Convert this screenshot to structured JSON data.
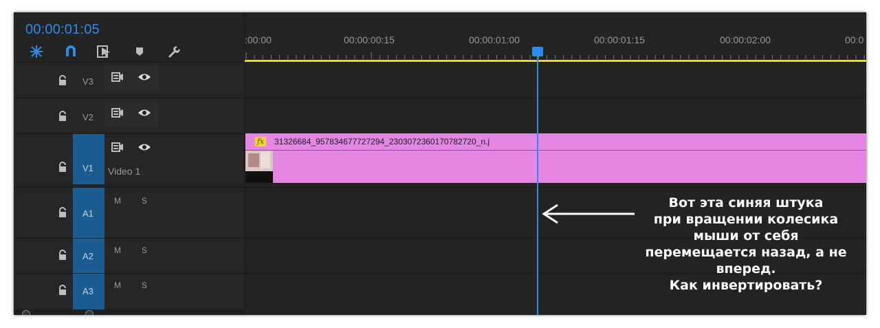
{
  "timecode": "00:00:01:05",
  "toolbar": {
    "tools": [
      "nest-icon",
      "snap-magnet-icon",
      "linked-selection-icon",
      "marker-icon",
      "wrench-icon"
    ]
  },
  "ruler": {
    "labels": [
      ":00:00",
      "00:00:00:15",
      "00:00:01:00",
      "00:00:01:15",
      "00:00:02:00",
      "00:0"
    ]
  },
  "tracks": {
    "v3": {
      "name": "V3"
    },
    "v2": {
      "name": "V2"
    },
    "v1": {
      "name": "V1",
      "label": "Video 1"
    },
    "a1": {
      "name": "A1",
      "mute": "M",
      "solo": "S"
    },
    "a2": {
      "name": "A2",
      "mute": "M",
      "solo": "S"
    },
    "a3": {
      "name": "A3",
      "mute": "M",
      "solo": "S"
    }
  },
  "clip": {
    "fx_label": "fx",
    "name": "31326684_957834677727294_2303072360170782720_n.j"
  },
  "annotation": {
    "lines": [
      "Вот эта синяя штука",
      "при вращении колесика",
      "мыши от себя",
      "перемещается назад, а не",
      "вперед.",
      "Как инвертировать?"
    ]
  },
  "colors": {
    "timecode": "#2d8ceb",
    "playhead": "#2d8ceb",
    "clip": "#e387e3",
    "work_area": "#e5dc26",
    "selected_track": "#1b5d91"
  }
}
